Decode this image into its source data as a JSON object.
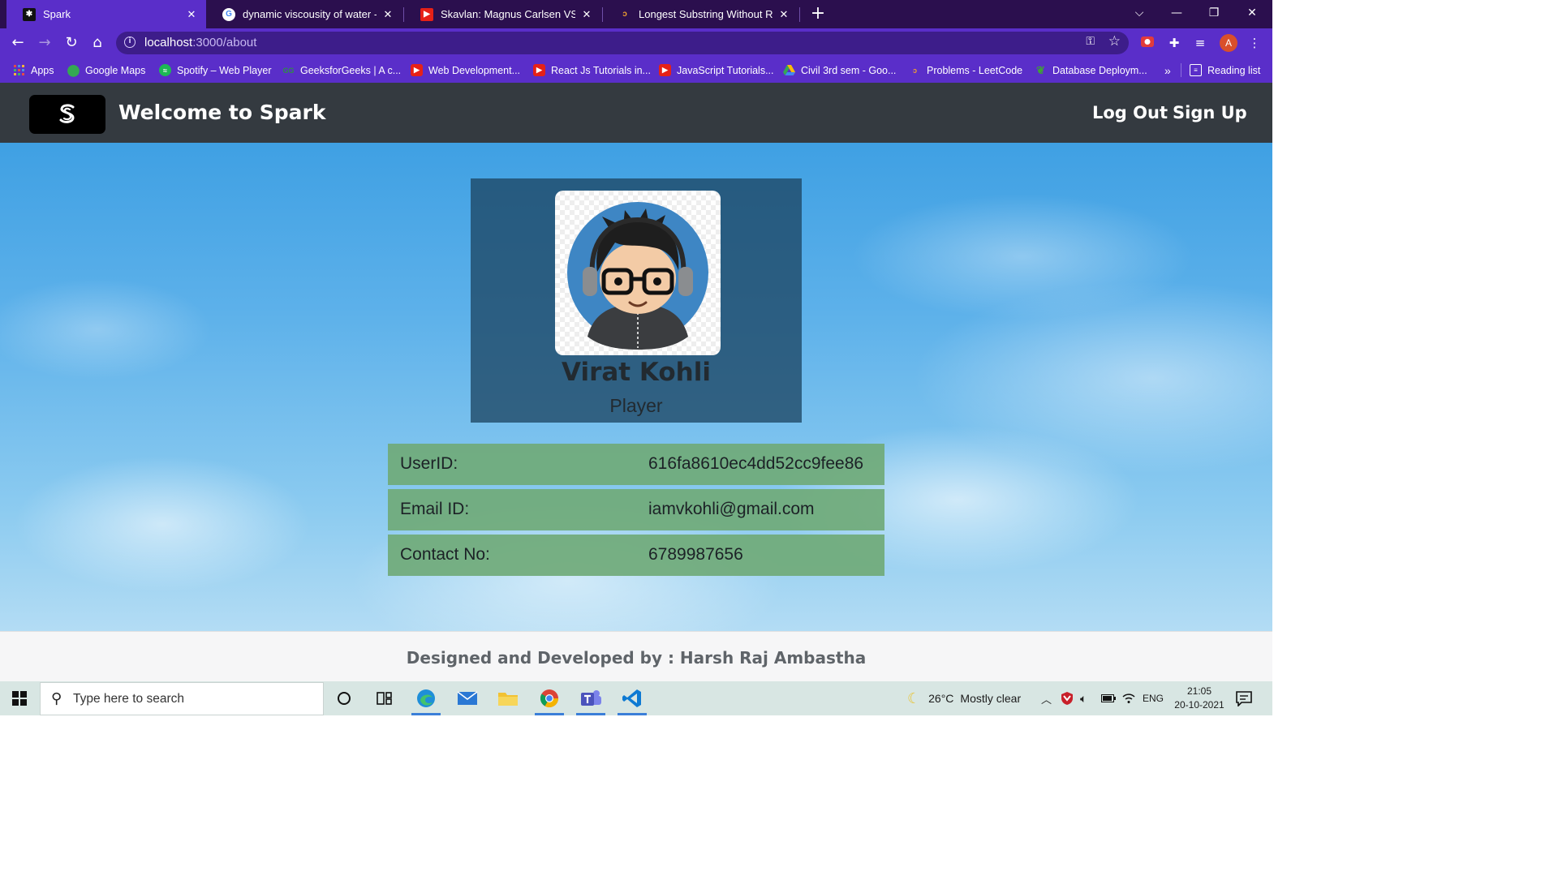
{
  "browser": {
    "tabs": [
      {
        "title": "Spark",
        "active": true
      },
      {
        "title": "dynamic viscousity of water - Go",
        "active": false
      },
      {
        "title": "Skavlan: Magnus Carlsen VS Bill G",
        "active": false
      },
      {
        "title": "Longest Substring Without Repea",
        "active": false
      }
    ],
    "url_host": "localhost",
    "url_path": ":3000/about",
    "profile_initial": "A",
    "bookmarks": [
      "Apps",
      "Google Maps",
      "Spotify – Web Player",
      "GeeksforGeeks | A c...",
      "Web Development...",
      "React Js Tutorials in...",
      "JavaScript Tutorials...",
      "Civil 3rd sem - Goo...",
      "Problems - LeetCode",
      "Database Deploym..."
    ],
    "bookmarks_overflow": "»",
    "reading_list": "Reading list"
  },
  "header": {
    "title": "Welcome to Spark",
    "nav": [
      "Log Out",
      "Sign Up"
    ]
  },
  "profile": {
    "name": "Virat Kohli",
    "role": "Player",
    "fields": [
      {
        "label": "UserID:",
        "value": "616fa8610ec4dd52cc9fee86"
      },
      {
        "label": "Email ID:",
        "value": "iamvkohli@gmail.com"
      },
      {
        "label": "Contact No:",
        "value": "6789987656"
      }
    ]
  },
  "footer": {
    "credit": "Designed and Developed by : Harsh Raj Ambastha"
  },
  "taskbar": {
    "search_placeholder": "Type here to search",
    "weather_temp": "26°C",
    "weather_text": "Mostly clear",
    "language": "ENG",
    "time": "21:05",
    "date": "20-10-2021"
  },
  "colors": {
    "tab_strip": "#2b0f4e",
    "browser_accent": "#5a2ec9",
    "app_header": "#343a40",
    "card_bg": "#1e4664",
    "field_bg": "#70aa78",
    "footer_text": "#5f6469"
  }
}
